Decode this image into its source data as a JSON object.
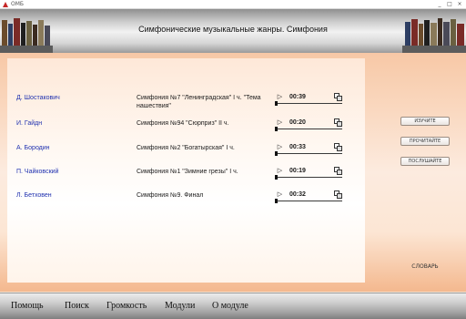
{
  "window": {
    "app_name": "ОМБ",
    "controls": [
      "_",
      "□",
      "×"
    ]
  },
  "header": {
    "title": "Симфонические музыкальные жанры. Симфония"
  },
  "tracks": [
    {
      "composer": "Д. Шостакович",
      "work": "Симфония №7 \"Ленинградская\" I ч. \"Тема нашествия\"",
      "duration": "00:39",
      "progress": 0.0
    },
    {
      "composer": "И. Гайдн",
      "work": "Симфония №94 \"Сюрприз\" II ч.",
      "duration": "00:20",
      "progress": 0.0
    },
    {
      "composer": "А. Бородин",
      "work": "Симфония №2 \"Богатырская\" I ч.",
      "duration": "00:33",
      "progress": 0.0
    },
    {
      "composer": "П. Чайковский",
      "work": "Симфония №1 \"Зимние грезы\" I ч.",
      "duration": "00:19",
      "progress": 0.0
    },
    {
      "composer": "Л. Бетховен",
      "work": "Симфония №9. Финал",
      "duration": "00:32",
      "progress": 0.0
    }
  ],
  "side_buttons": {
    "study": "ИЗУЧИТЕ",
    "read": "ПРОЧИТАЙТЕ",
    "listen": "ПОСЛУШАЙТЕ",
    "dictionary": "СЛОВАРЬ"
  },
  "menu": {
    "help": "Помощь",
    "search": "Поиск",
    "volume": "Громкость",
    "modules": "Модули",
    "about": "О модуле"
  },
  "icons": {
    "play": "play-icon",
    "copy": "copy-icon"
  },
  "colors": {
    "composer_link": "#2233b0",
    "accent_background": "#f7c8a6",
    "menu_bar": "#a8a8a8"
  }
}
